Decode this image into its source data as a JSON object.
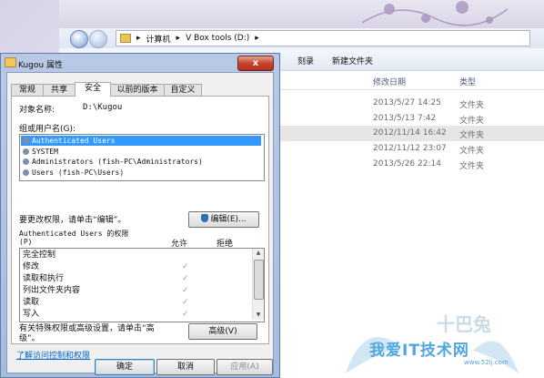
{
  "explorer": {
    "breadcrumb": [
      "计算机",
      "V Box tools (D:)"
    ],
    "toolbar": {
      "burn": "刻录",
      "new_folder": "新建文件夹"
    },
    "columns": {
      "modified": "修改日期",
      "type": "类型"
    },
    "rows": [
      {
        "date": "2013/5/27 14:25",
        "type": "文件夹"
      },
      {
        "date": "2013/5/13 7:42",
        "type": "文件夹"
      },
      {
        "date": "2012/11/14 16:42",
        "type": "文件夹"
      },
      {
        "date": "2012/11/12 23:07",
        "type": "文件夹"
      },
      {
        "date": "2013/5/26 22:14",
        "type": "文件夹"
      }
    ],
    "watermark": {
      "brand": "十巴兔",
      "text": "我爱IT技术网",
      "url": "www.52ij.com"
    }
  },
  "dialog": {
    "title": "Kugou 属性",
    "close": "x",
    "tabs": [
      "常规",
      "共享",
      "安全",
      "以前的版本",
      "自定义"
    ],
    "active_tab": "安全",
    "object_label": "对象名称:",
    "object_value": "D:\\Kugou",
    "group_label": "组或用户名(G):",
    "users": [
      "Authenticated Users",
      "SYSTEM",
      "Administrators (fish-PC\\Administrators)",
      "Users (fish-PC\\Users)"
    ],
    "selected_user": "Authenticated Users",
    "change_hint": "要更改权限，请单击“编辑”。",
    "edit_button": "编辑(E)...",
    "perm_label_line1": "Authenticated Users 的权限",
    "perm_label_line2": "(P)",
    "allow": "允许",
    "deny": "拒绝",
    "permissions": [
      {
        "name": "完全控制",
        "allow": ""
      },
      {
        "name": "修改",
        "allow": "✓"
      },
      {
        "name": "读取和执行",
        "allow": "✓"
      },
      {
        "name": "列出文件夹内容",
        "allow": "✓"
      },
      {
        "name": "读取",
        "allow": "✓"
      },
      {
        "name": "写入",
        "allow": "✓"
      }
    ],
    "special_hint_line1": "有关特殊权限或高级设置，请单击“高",
    "special_hint_line2": "级”。",
    "advanced_button": "高级(V)",
    "link": "了解访问控制和权限",
    "ok": "确定",
    "cancel": "取消",
    "apply": "应用(A)"
  }
}
